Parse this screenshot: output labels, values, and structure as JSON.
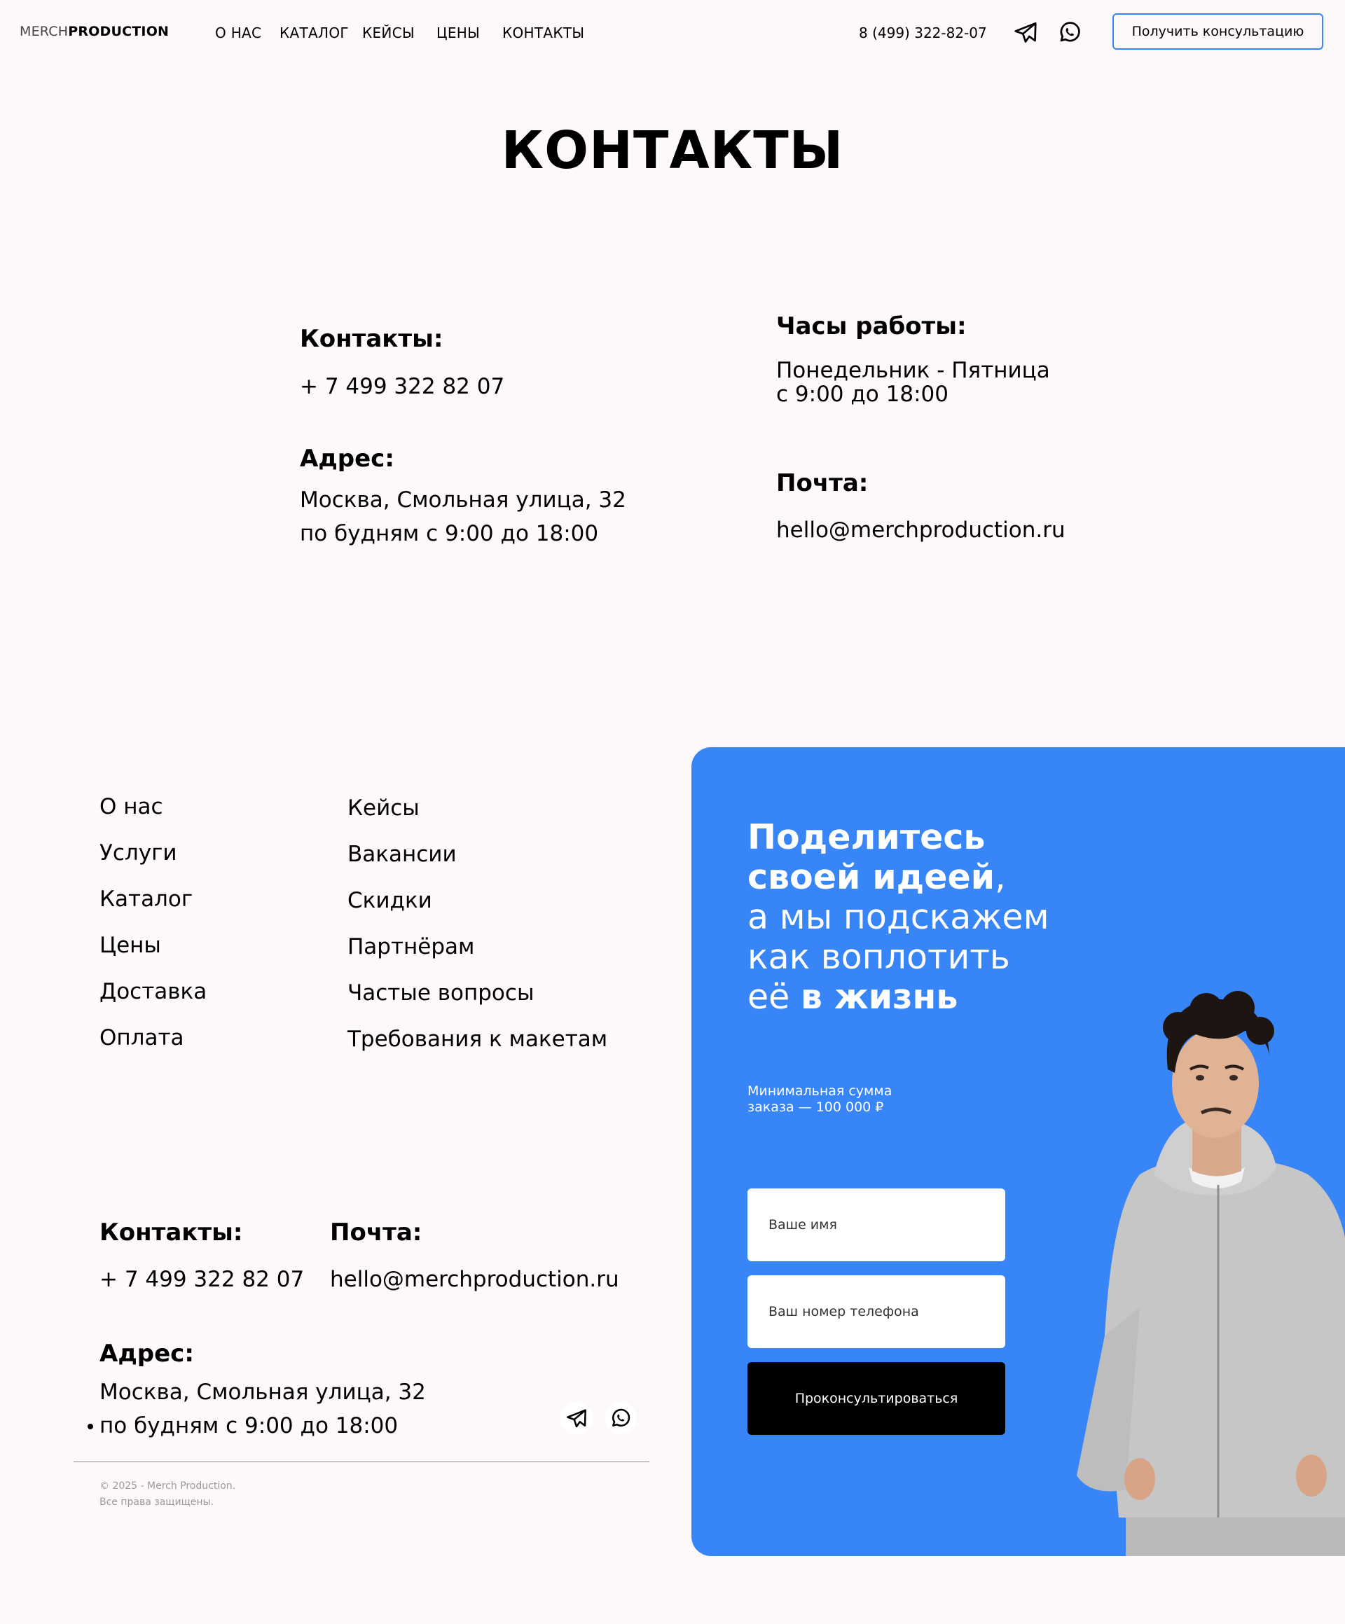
{
  "header": {
    "logo_light": "MERCH",
    "logo_bold": "PRODUCTION",
    "nav": [
      "О НАС",
      "КАТАЛОГ",
      "КЕЙСЫ",
      "ЦЕНЫ",
      "КОНТАКТЫ"
    ],
    "phone": "8 (499) 322-82-07",
    "icons": [
      "telegram-icon",
      "whatsapp-icon"
    ],
    "consult_label": "Получить консультацию"
  },
  "page_title": "КОНТАКТЫ",
  "contacts": {
    "contacts_heading": "Контакты:",
    "phone": "+ 7 499 322 82 07",
    "address_heading": "Адрес:",
    "address": "Москва, Смольная улица, 32",
    "schedule": "по будням с 9:00 до 18:00",
    "hours_heading": "Часы работы:",
    "hours_days": "Понедельник - Пятница",
    "hours_time": "с 9:00 до 18:00",
    "email_heading": "Почта:",
    "email": "hello@merchproduction.ru"
  },
  "footer": {
    "menu_left": [
      "О нас",
      "Услуги",
      "Каталог",
      "Цены",
      "Доставка",
      "Оплата"
    ],
    "menu_right": [
      "Кейсы",
      "Вакансии",
      "Скидки",
      "Партнёрам",
      "Частые вопросы",
      "Требования к макетам"
    ],
    "contacts_heading": "Контакты:",
    "phone": "+ 7 499 322 82 07",
    "email_heading": "Почта:",
    "email": "hello@merchproduction.ru",
    "address_heading": "Адрес:",
    "address": "Москва, Смольная улица, 32",
    "schedule": "по будням с 9:00 до 18:00",
    "copyright_line1": "© 2025 - Merch Production.",
    "copyright_line2": "Все права защищены."
  },
  "form": {
    "title_bold_1": "Поделитесь",
    "title_bold_2": "своей идеей",
    "title_comma": ",",
    "title_normal_1": "а мы подскажем",
    "title_normal_2": "как воплотить",
    "title_normal_3": "её ",
    "title_bold_3": "в жизнь",
    "min_sum": "Минимальная сумма заказа — 100 000 ₽",
    "name_placeholder": "Ваше имя",
    "phone_placeholder": "Ваш номер телефона",
    "submit_label": "Проконсультироваться"
  },
  "colors": {
    "accent": "#3785f7",
    "background": "#fcf9f8",
    "button_dark": "#000000"
  }
}
